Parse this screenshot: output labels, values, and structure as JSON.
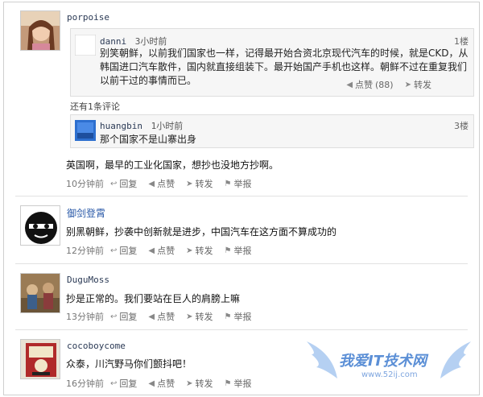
{
  "actions": {
    "reply": "回复",
    "like": "点赞",
    "forward": "转发",
    "report": "举报"
  },
  "posts": [
    {
      "username": "porpoise",
      "quote": {
        "username": "danni",
        "time": "3小时前",
        "floor": "1楼",
        "text": "别笑朝鲜，以前我们国家也一样，记得最开始合资北京现代汽车的时候，就是CKD，从韩国进口汽车散件，国内就直接组装下。最开始国产手机也这样。朝鲜不过在重复我们以前干过的事情而已。",
        "like": "点赞",
        "like_count": "(88)",
        "forward": "转发"
      },
      "more_comments": "还有1条评论",
      "reply": {
        "username": "huangbin",
        "time": "1小时前",
        "floor": "3楼",
        "text": "那个国家不是山寨出身"
      },
      "content": "英国啊，最早的工业化国家，想抄也没地方抄啊。",
      "time": "10分钟前"
    },
    {
      "username": "御剑登霄",
      "content": "别黑朝鲜，抄袭中创新就是进步，中国汽车在这方面不算成功的",
      "time": "12分钟前"
    },
    {
      "username": "DuguMoss",
      "content": "抄是正常的。我们要站在巨人的肩膀上嘛",
      "time": "13分钟前"
    },
    {
      "username": "cocoboycome",
      "content": "众泰，川汽野马你们颤抖吧！",
      "time": "16分钟前"
    }
  ],
  "watermark": {
    "title": "我爱IT技术网",
    "url": "www.52ij.com"
  },
  "colors": {
    "link": "#2b5aa8",
    "muted": "#777777",
    "quote_bg": "#f6f6f6",
    "watermark": "#5b8fd6"
  }
}
